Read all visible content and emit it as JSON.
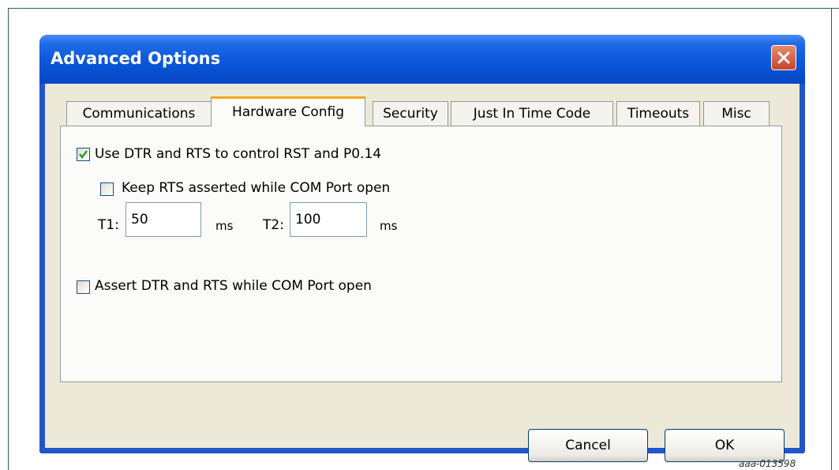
{
  "window": {
    "title": "Advanced Options"
  },
  "tabs": [
    {
      "label": "Communications",
      "active": false
    },
    {
      "label": "Hardware Config",
      "active": true
    },
    {
      "label": "Security",
      "active": false
    },
    {
      "label": "Just In Time Code",
      "active": false
    },
    {
      "label": "Timeouts",
      "active": false
    },
    {
      "label": "Misc",
      "active": false
    }
  ],
  "hardware": {
    "use_dtr_rts": {
      "label": "Use DTR and RTS to control RST and P0.14",
      "checked": true
    },
    "keep_rts": {
      "label": "Keep RTS asserted while COM Port open",
      "checked": false
    },
    "t1": {
      "label": "T1:",
      "value": "50",
      "unit": "ms"
    },
    "t2": {
      "label": "T2:",
      "value": "100",
      "unit": "ms"
    },
    "assert_dtr_rts": {
      "label": "Assert DTR and RTS while COM Port open",
      "checked": false
    }
  },
  "buttons": {
    "cancel": "Cancel",
    "ok": "OK"
  },
  "figure_id": "aaa-013598"
}
